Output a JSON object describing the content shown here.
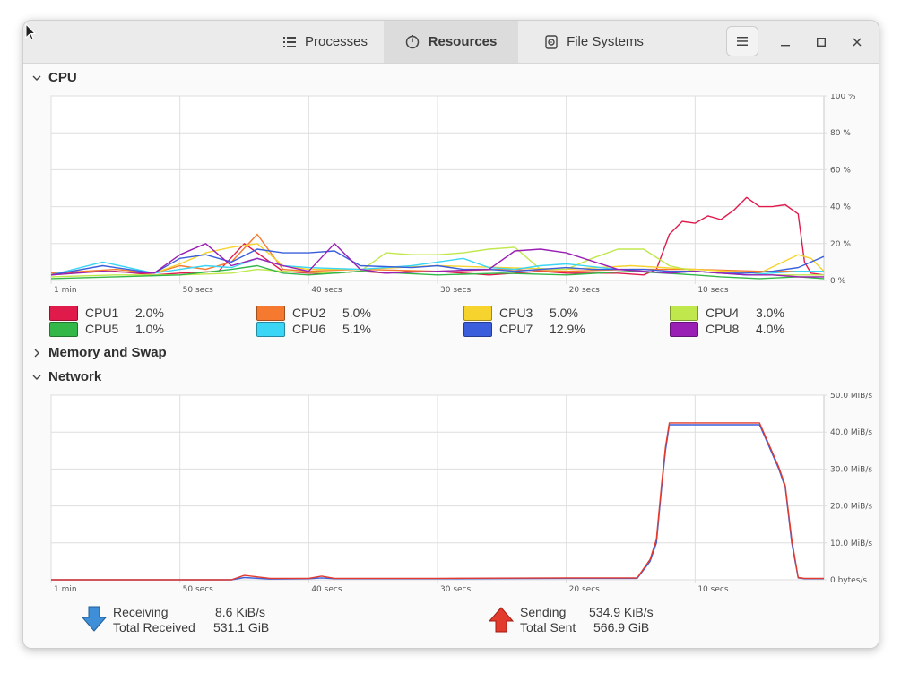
{
  "tabs": [
    {
      "label": "Processes",
      "icon": "list-icon"
    },
    {
      "label": "Resources",
      "icon": "gauge-icon"
    },
    {
      "label": "File Systems",
      "icon": "disk-icon"
    }
  ],
  "sections": {
    "cpu": "CPU",
    "memory": "Memory and Swap",
    "network": "Network"
  },
  "cpu_legend": [
    {
      "name": "CPU1",
      "value": "2.0%",
      "color": "#e01b4c"
    },
    {
      "name": "CPU2",
      "value": "5.0%",
      "color": "#f57a2f"
    },
    {
      "name": "CPU3",
      "value": "5.0%",
      "color": "#f6d32d"
    },
    {
      "name": "CPU4",
      "value": "3.0%",
      "color": "#c0e84d"
    },
    {
      "name": "CPU5",
      "value": "1.0%",
      "color": "#33b748"
    },
    {
      "name": "CPU6",
      "value": "5.1%",
      "color": "#3bd5f5"
    },
    {
      "name": "CPU7",
      "value": "12.9%",
      "color": "#3b5fdc"
    },
    {
      "name": "CPU8",
      "value": "4.0%",
      "color": "#9a1fb4"
    }
  ],
  "network": {
    "receiving_label": "Receiving",
    "receiving_value": "8.6 KiB/s",
    "total_received_label": "Total Received",
    "total_received_value": "531.1 GiB",
    "sending_label": "Sending",
    "sending_value": "534.9 KiB/s",
    "total_sent_label": "Total Sent",
    "total_sent_value": "566.9 GiB"
  },
  "chart_data": [
    {
      "type": "line",
      "x_ticks": [
        "1 min",
        "50 secs",
        "40 secs",
        "30 secs",
        "20 secs",
        "10 secs"
      ],
      "x_tick_values": [
        60,
        50,
        40,
        30,
        20,
        10
      ],
      "y_ticks": [
        "100 %",
        "80 %",
        "60 %",
        "40 %",
        "20 %",
        "0 %"
      ],
      "y_tick_values": [
        100,
        80,
        60,
        40,
        20,
        0
      ],
      "ylim": [
        0,
        100
      ],
      "xlim": [
        60,
        0
      ],
      "grid": true,
      "series": [
        {
          "name": "CPU1",
          "color": "#e01b4c",
          "x": [
            60,
            55,
            52,
            50,
            47,
            45,
            42,
            40,
            38,
            36,
            34,
            32,
            30,
            28,
            26,
            24,
            22,
            20,
            18,
            16,
            14,
            13,
            12,
            11,
            10,
            9,
            8,
            7,
            6,
            5,
            4,
            3,
            2,
            1.5,
            1,
            0
          ],
          "y": [
            4,
            5,
            3,
            4,
            5,
            20,
            5,
            4,
            4,
            5,
            4,
            5,
            5,
            4,
            3,
            4,
            5,
            4,
            4,
            4,
            3,
            6,
            25,
            32,
            31,
            35,
            33,
            38,
            45,
            40,
            40,
            41,
            36,
            10,
            4,
            3
          ]
        },
        {
          "name": "CPU2",
          "color": "#f57a2f",
          "x": [
            60,
            55,
            52,
            50,
            48,
            46,
            44,
            42,
            40,
            36,
            30,
            25,
            20,
            15,
            10,
            5,
            0
          ],
          "y": [
            4,
            6,
            4,
            8,
            6,
            10,
            25,
            6,
            5,
            6,
            5,
            6,
            5,
            6,
            6,
            5,
            5
          ]
        },
        {
          "name": "CPU3",
          "color": "#f6d32d",
          "x": [
            60,
            56,
            52,
            50,
            48,
            46,
            44,
            42,
            40,
            36,
            30,
            25,
            20,
            15,
            10,
            5,
            2,
            1,
            0
          ],
          "y": [
            3,
            5,
            4,
            9,
            15,
            18,
            20,
            8,
            6,
            6,
            8,
            7,
            6,
            8,
            6,
            4,
            14,
            12,
            5
          ]
        },
        {
          "name": "CPU4",
          "color": "#c0e84d",
          "x": [
            60,
            55,
            50,
            46,
            44,
            42,
            38,
            36,
            34,
            32,
            30,
            28,
            26,
            24,
            22,
            20,
            18,
            16,
            14,
            12,
            10,
            8,
            6,
            4,
            2,
            0
          ],
          "y": [
            2,
            3,
            3,
            4,
            6,
            5,
            4,
            5,
            15,
            14,
            14,
            15,
            17,
            18,
            6,
            6,
            12,
            17,
            17,
            8,
            5,
            4,
            3,
            3,
            3,
            3
          ]
        },
        {
          "name": "CPU5",
          "color": "#33b748",
          "x": [
            60,
            55,
            50,
            46,
            44,
            42,
            40,
            36,
            30,
            25,
            20,
            15,
            10,
            8,
            5,
            2,
            0
          ],
          "y": [
            1,
            2,
            3,
            6,
            8,
            4,
            3,
            5,
            3,
            4,
            3,
            5,
            3,
            2,
            1,
            2,
            1
          ]
        },
        {
          "name": "CPU6",
          "color": "#3bd5f5",
          "x": [
            60,
            56,
            52,
            50,
            48,
            46,
            44,
            42,
            40,
            36,
            32,
            30,
            28,
            26,
            24,
            22,
            20,
            16,
            14,
            12,
            10,
            6,
            2,
            0
          ],
          "y": [
            3,
            10,
            4,
            6,
            8,
            7,
            12,
            8,
            7,
            6,
            8,
            10,
            12,
            7,
            6,
            8,
            9,
            6,
            5,
            4,
            5,
            3,
            5,
            5
          ]
        },
        {
          "name": "CPU7",
          "color": "#3b5fdc",
          "x": [
            60,
            56,
            52,
            50,
            48,
            46,
            44,
            42,
            40,
            38,
            36,
            32,
            30,
            28,
            26,
            24,
            22,
            20,
            18,
            14,
            12,
            10,
            8,
            6,
            4,
            2,
            1,
            0
          ],
          "y": [
            3,
            8,
            4,
            12,
            14,
            10,
            17,
            15,
            15,
            16,
            8,
            7,
            8,
            6,
            6,
            5,
            6,
            7,
            6,
            6,
            5,
            5,
            4,
            4,
            5,
            7,
            10,
            13
          ]
        },
        {
          "name": "CPU8",
          "color": "#9a1fb4",
          "x": [
            60,
            56,
            52,
            50,
            48,
            46,
            44,
            42,
            40,
            38,
            36,
            34,
            30,
            26,
            24,
            22,
            20,
            16,
            14,
            12,
            10,
            8,
            6,
            4,
            2,
            0
          ],
          "y": [
            3,
            5,
            4,
            14,
            20,
            8,
            12,
            8,
            5,
            20,
            6,
            4,
            5,
            6,
            16,
            17,
            15,
            6,
            5,
            4,
            5,
            4,
            3,
            3,
            2,
            2
          ]
        }
      ]
    },
    {
      "type": "line",
      "x_ticks": [
        "1 min",
        "50 secs",
        "40 secs",
        "30 secs",
        "20 secs",
        "10 secs"
      ],
      "x_tick_values": [
        60,
        50,
        40,
        30,
        20,
        10
      ],
      "y_ticks": [
        "50.0 MiB/s",
        "40.0 MiB/s",
        "30.0 MiB/s",
        "20.0 MiB/s",
        "10.0 MiB/s",
        "0 bytes/s"
      ],
      "y_tick_values": [
        50,
        40,
        30,
        20,
        10,
        0
      ],
      "ylim": [
        0,
        50
      ],
      "xlim": [
        60,
        0
      ],
      "grid": true,
      "series": [
        {
          "color": "#3b5fdc",
          "x": [
            60,
            46,
            45,
            43,
            40,
            39,
            38,
            30,
            20,
            14.5,
            13.5,
            13,
            12.6,
            12.3,
            12,
            11,
            8,
            7,
            6,
            5.5,
            5,
            4.5,
            3.5,
            3,
            2.5,
            2,
            1.5,
            1,
            0
          ],
          "y": [
            0,
            0,
            0.6,
            0.2,
            0.3,
            0.5,
            0.3,
            0.3,
            0.4,
            0.4,
            5,
            10,
            25,
            35,
            42,
            42,
            42,
            42,
            42,
            42,
            42,
            38,
            30,
            25,
            10,
            0.5,
            0.3,
            0.3,
            0.3
          ]
        },
        {
          "color": "#e23b2e",
          "x": [
            60,
            46,
            45,
            43,
            40,
            39,
            38,
            30,
            20,
            14.5,
            13.5,
            13,
            12.6,
            12.3,
            12,
            11,
            8,
            7,
            6,
            5.5,
            5,
            4.5,
            3.5,
            3,
            2.5,
            2,
            1.5,
            1,
            0
          ],
          "y": [
            0,
            0,
            1.2,
            0.4,
            0.4,
            1,
            0.4,
            0.4,
            0.5,
            0.5,
            5.5,
            11,
            26,
            36,
            42.5,
            42.5,
            42.5,
            42.5,
            42.5,
            42.5,
            42.5,
            38.5,
            30.5,
            25.5,
            11,
            0.6,
            0.4,
            0.4,
            0.4
          ]
        }
      ]
    }
  ]
}
